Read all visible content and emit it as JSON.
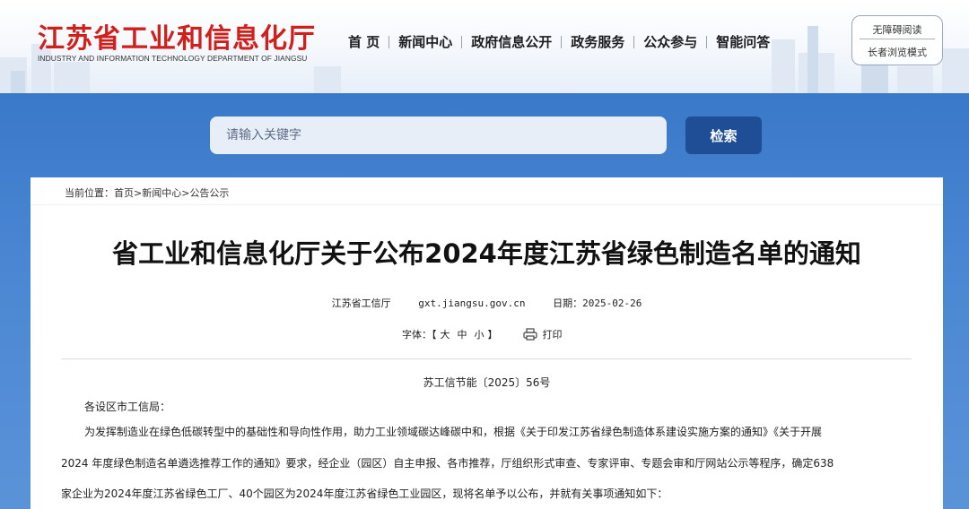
{
  "header": {
    "logo_cn": "江苏省工业和信息化厅",
    "logo_en": "INDUSTRY AND INFORMATION TECHNOLOGY DEPARTMENT OF JIANGSU",
    "nav": [
      "首 页",
      "新闻中心",
      "政府信息公开",
      "政务服务",
      "公众参与",
      "智能问答"
    ],
    "accessibility": "无障碍阅读",
    "elder_mode": "长者浏览模式"
  },
  "search": {
    "placeholder": "请输入关键字",
    "button": "检索"
  },
  "breadcrumb": {
    "prefix": "当前位置：",
    "items": [
      "首页",
      "新闻中心",
      "公告公示"
    ],
    "sep": ">"
  },
  "article": {
    "title": "省工业和信息化厅关于公布2024年度江苏省绿色制造名单的通知",
    "source": "江苏省工信厅",
    "site": "gxt.jiangsu.gov.cn",
    "date": "日期：2025-02-26",
    "font_label": "字体：【",
    "font_sizes": [
      "大",
      "中",
      "小"
    ],
    "font_close": "】",
    "print": "打印",
    "doc_number": "苏工信节能〔2025〕56号",
    "salutation": "各设区市工信局：",
    "paragraph_lines": [
      "为发挥制造业在绿色低碳转型中的基础性和导向性作用，助力工业领域碳达峰碳中和，根据《关于印发江苏省绿色制造体系建设实施方案的通知》《关于开展",
      "2024 年度绿色制造名单遴选推荐工作的通知》要求，经企业（园区）自主申报、各市推荐，厅组织形式审查、专家评审、专题会审和厅网站公示等程序，确定638",
      "家企业为2024年度江苏省绿色工厂、40个园区为2024年度江苏省绿色工业园区，现将名单予以公布，并就有关事项通知如下："
    ]
  }
}
